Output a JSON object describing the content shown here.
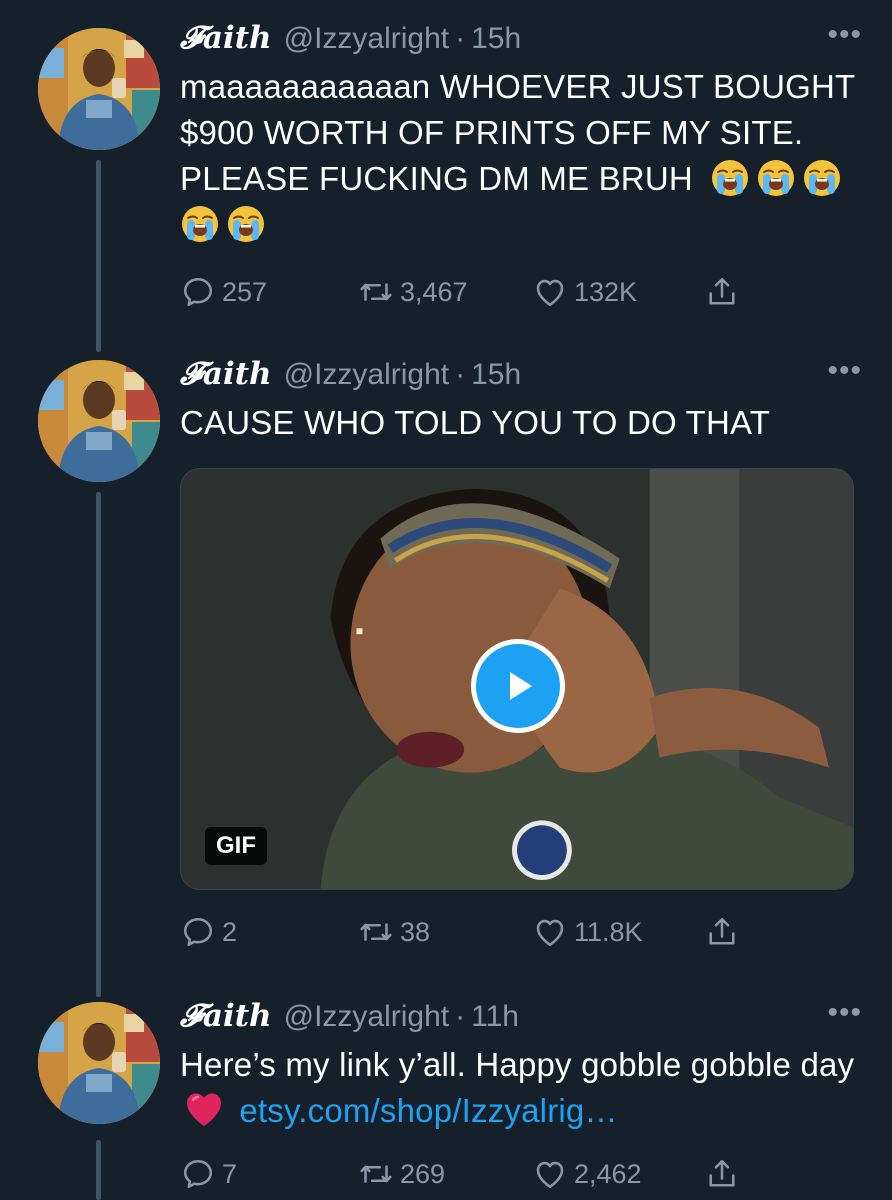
{
  "tweets": [
    {
      "name": "𝓕aith",
      "handle": "@Izzyalright",
      "time": "15h",
      "more": "•••",
      "text": "maaaaaaaaaaan WHOEVER JUST BOUGHT $900 WORTH OF PRINTS OFF MY SITE. PLEASE FUCKING DM ME BRUH",
      "emojis": [
        "loudly-crying-face",
        "loudly-crying-face",
        "loudly-crying-face",
        "loudly-crying-face",
        "loudly-crying-face"
      ],
      "replies": "257",
      "retweets": "3,467",
      "likes": "132K"
    },
    {
      "name": "𝓕aith",
      "handle": "@Izzyalright",
      "time": "15h",
      "more": "•••",
      "text": "CAUSE WHO TOLD YOU TO DO THAT",
      "media": {
        "type": "gif",
        "badge": "GIF",
        "button_icon": "play-icon"
      },
      "replies": "2",
      "retweets": "38",
      "likes": "11.8K"
    },
    {
      "name": "𝓕aith",
      "handle": "@Izzyalright",
      "time": "11h",
      "more": "•••",
      "text": "Here’s my link y’all. Happy gobble gobble day",
      "emoji": "red-heart",
      "link": "etsy.com/shop/Izzyalrig…",
      "replies": "7",
      "retweets": "269",
      "likes": "2,462"
    }
  ],
  "colors": {
    "background": "#15202b",
    "secondary_text": "#8899a6",
    "link": "#1da1f2",
    "thread_line": "#3d5466"
  },
  "icons": [
    "reply-icon",
    "retweet-icon",
    "like-icon",
    "share-icon",
    "more-icon"
  ]
}
